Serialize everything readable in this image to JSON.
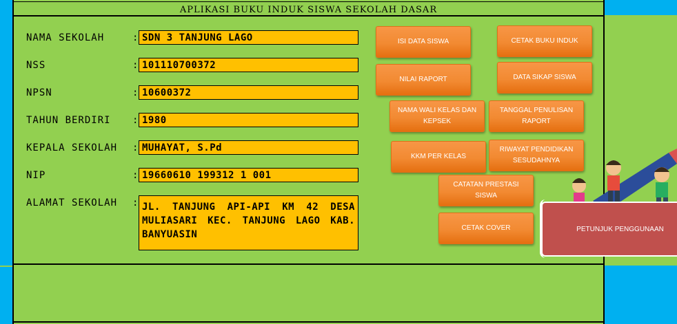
{
  "app": {
    "title": "APLIKASI BUKU INDUK SISWA SEKOLAH DASAR"
  },
  "school": {
    "fields": [
      {
        "label": "NAMA SEKOLAH",
        "value": "SDN 3 TANJUNG LAGO"
      },
      {
        "label": "NSS",
        "value": "101110700372"
      },
      {
        "label": "NPSN",
        "value": "10600372"
      },
      {
        "label": "TAHUN BERDIRI",
        "value": "1980"
      },
      {
        "label": "KEPALA SEKOLAH",
        "value": "MUHAYAT, S.Pd"
      },
      {
        "label": "NIP",
        "value": "19660610 199312 1 001"
      },
      {
        "label": "ALAMAT SEKOLAH",
        "value": "JL. TANJUNG API-API KM 42 DESA MULIASARI KEC. TANJUNG LAGO KAB. BANYUASIN"
      }
    ],
    "separator": ":"
  },
  "buttons": {
    "isi_data": "ISI DATA SISWA",
    "cetak_buku": "CETAK BUKU INDUK",
    "nilai_raport": "NILAI RAPORT",
    "data_sikap": "DATA SIKAP SISWA",
    "nama_wali": "NAMA WALI KELAS DAN KEPSEK",
    "tanggal_penulisan": "TANGGAL PENULISAN RAPORT",
    "kkm": "KKM PER KELAS",
    "riwayat": "RIWAYAT PENDIDIKAN SESUDAHNYA",
    "catatan": "CATATAN PRESTASI SISWA",
    "cetak_cover": "CETAK COVER",
    "petunjuk": "PETUNJUK PENGGUNAAN"
  },
  "colors": {
    "background": "#92d050",
    "side_panel": "#00b0f0",
    "field": "#ffc000",
    "button": "#f79646",
    "petunjuk": "#c0504d"
  }
}
